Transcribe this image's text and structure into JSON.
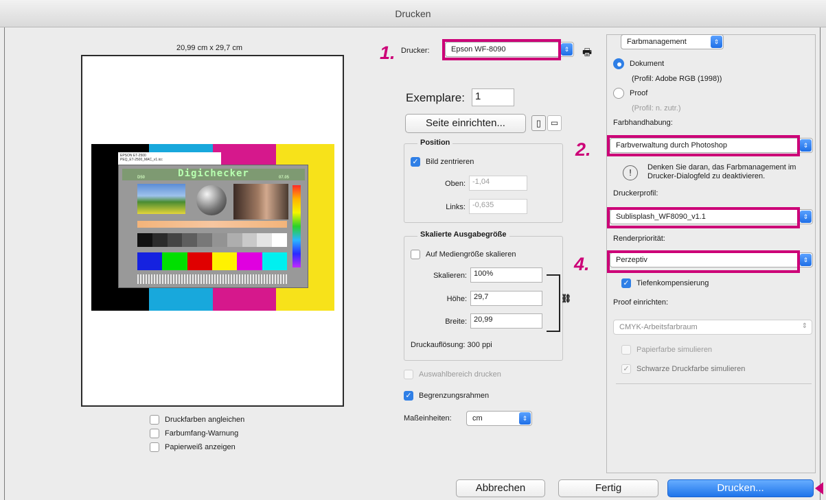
{
  "window": {
    "title": "Drucken"
  },
  "preview": {
    "paper_size": "20,99 cm x 29,7 cm",
    "chart_label_line1": "EPSON ET-2500",
    "chart_label_line2": "PEQ_ET-2500_MAC_v1.icc",
    "chart_title": "Digichecker",
    "chart_tag_left": "D50",
    "chart_tag_right": "07.05",
    "options": [
      {
        "label": "Druckfarben angleichen",
        "checked": false
      },
      {
        "label": "Farbumfang-Warnung",
        "checked": false
      },
      {
        "label": "Papierweiß anzeigen",
        "checked": false
      }
    ]
  },
  "annotations": {
    "step1": "1.",
    "step2": "2.",
    "step4": "4."
  },
  "printer": {
    "label": "Drucker:",
    "value": "Epson WF-8090"
  },
  "copies": {
    "label": "Exemplare:",
    "value": "1"
  },
  "page_setup_button": "Seite einrichten...",
  "position": {
    "title": "Position",
    "center_label": "Bild zentrieren",
    "center_checked": true,
    "top_label": "Oben:",
    "top_value": "-1,04",
    "left_label": "Links:",
    "left_value": "-0,635"
  },
  "scaled": {
    "title": "Skalierte Ausgabegröße",
    "fit_label": "Auf Mediengröße skalieren",
    "scale_label": "Skalieren:",
    "scale_value": "100%",
    "height_label": "Höhe:",
    "height_value": "29,7",
    "width_label": "Breite:",
    "width_value": "20,99",
    "resolution": "Druckauflösung: 300 ppi"
  },
  "print_selection": "Auswahlbereich drucken",
  "bounding_box": "Begrenzungsrahmen",
  "units": {
    "label": "Maßeinheiten:",
    "value": "cm"
  },
  "color_panel": {
    "section": "Farbmanagement",
    "document_label": "Dokument",
    "document_profile": "(Profil: Adobe RGB (1998))",
    "proof_label": "Proof",
    "proof_profile": "(Profil: n. zutr.)",
    "handling_label": "Farbhandhabung:",
    "handling_value": "Farbverwaltung durch Photoshop",
    "warning": "Denken Sie daran, das Farbmanagement im Drucker-Dialogfeld zu deaktivieren.",
    "profile_label": "Druckerprofil:",
    "profile_value": "Sublisplash_WF8090_v1.1",
    "intent_label": "Renderpriorität:",
    "intent_value": "Perzeptiv",
    "bpc_label": "Tiefenkompensierung",
    "proof_setup_label": "Proof einrichten:",
    "proof_setup_value": "CMYK-Arbeitsfarbraum",
    "paper_color_label": "Papierfarbe simulieren",
    "black_ink_label": "Schwarze Druckfarbe simulieren"
  },
  "buttons": {
    "cancel": "Abbrechen",
    "done": "Fertig",
    "print": "Drucken..."
  },
  "colors": {
    "accent": "#2f7fe6",
    "highlight": "#cc0077"
  }
}
